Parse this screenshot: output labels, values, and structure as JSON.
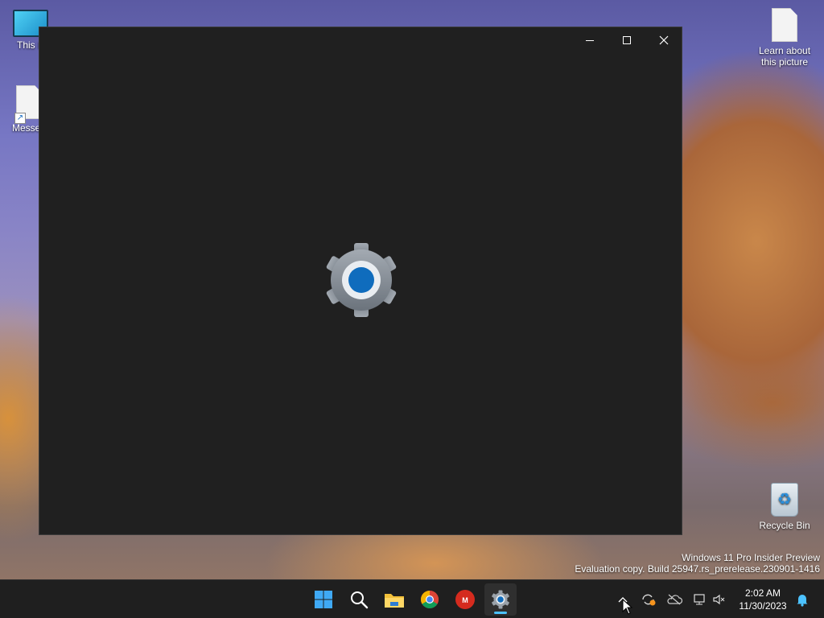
{
  "desktop": {
    "icons": [
      {
        "label": "This P"
      },
      {
        "label": "Messen"
      },
      {
        "label": "Learn about this picture"
      },
      {
        "label": "Recycle Bin"
      }
    ],
    "watermark": {
      "line1": "Windows 11 Pro Insider Preview",
      "line2": "Evaluation copy. Build 25947.rs_prerelease.230901-1416"
    }
  },
  "window": {
    "app_icon": "settings-gear-icon",
    "caption_buttons": [
      "minimize",
      "maximize",
      "close"
    ],
    "state": "loading splash"
  },
  "taskbar": {
    "apps": [
      "start",
      "search",
      "file-explorer",
      "chrome",
      "mcafee",
      "settings"
    ],
    "active_app": "settings",
    "clock": {
      "time": "2:02 AM",
      "date": "11/30/2023"
    }
  },
  "colors": {
    "window_bg": "#202020",
    "taskbar_bg": "#1f1f1f",
    "accent": "#4cc2ff",
    "gear_center": "#0f6cbd"
  }
}
